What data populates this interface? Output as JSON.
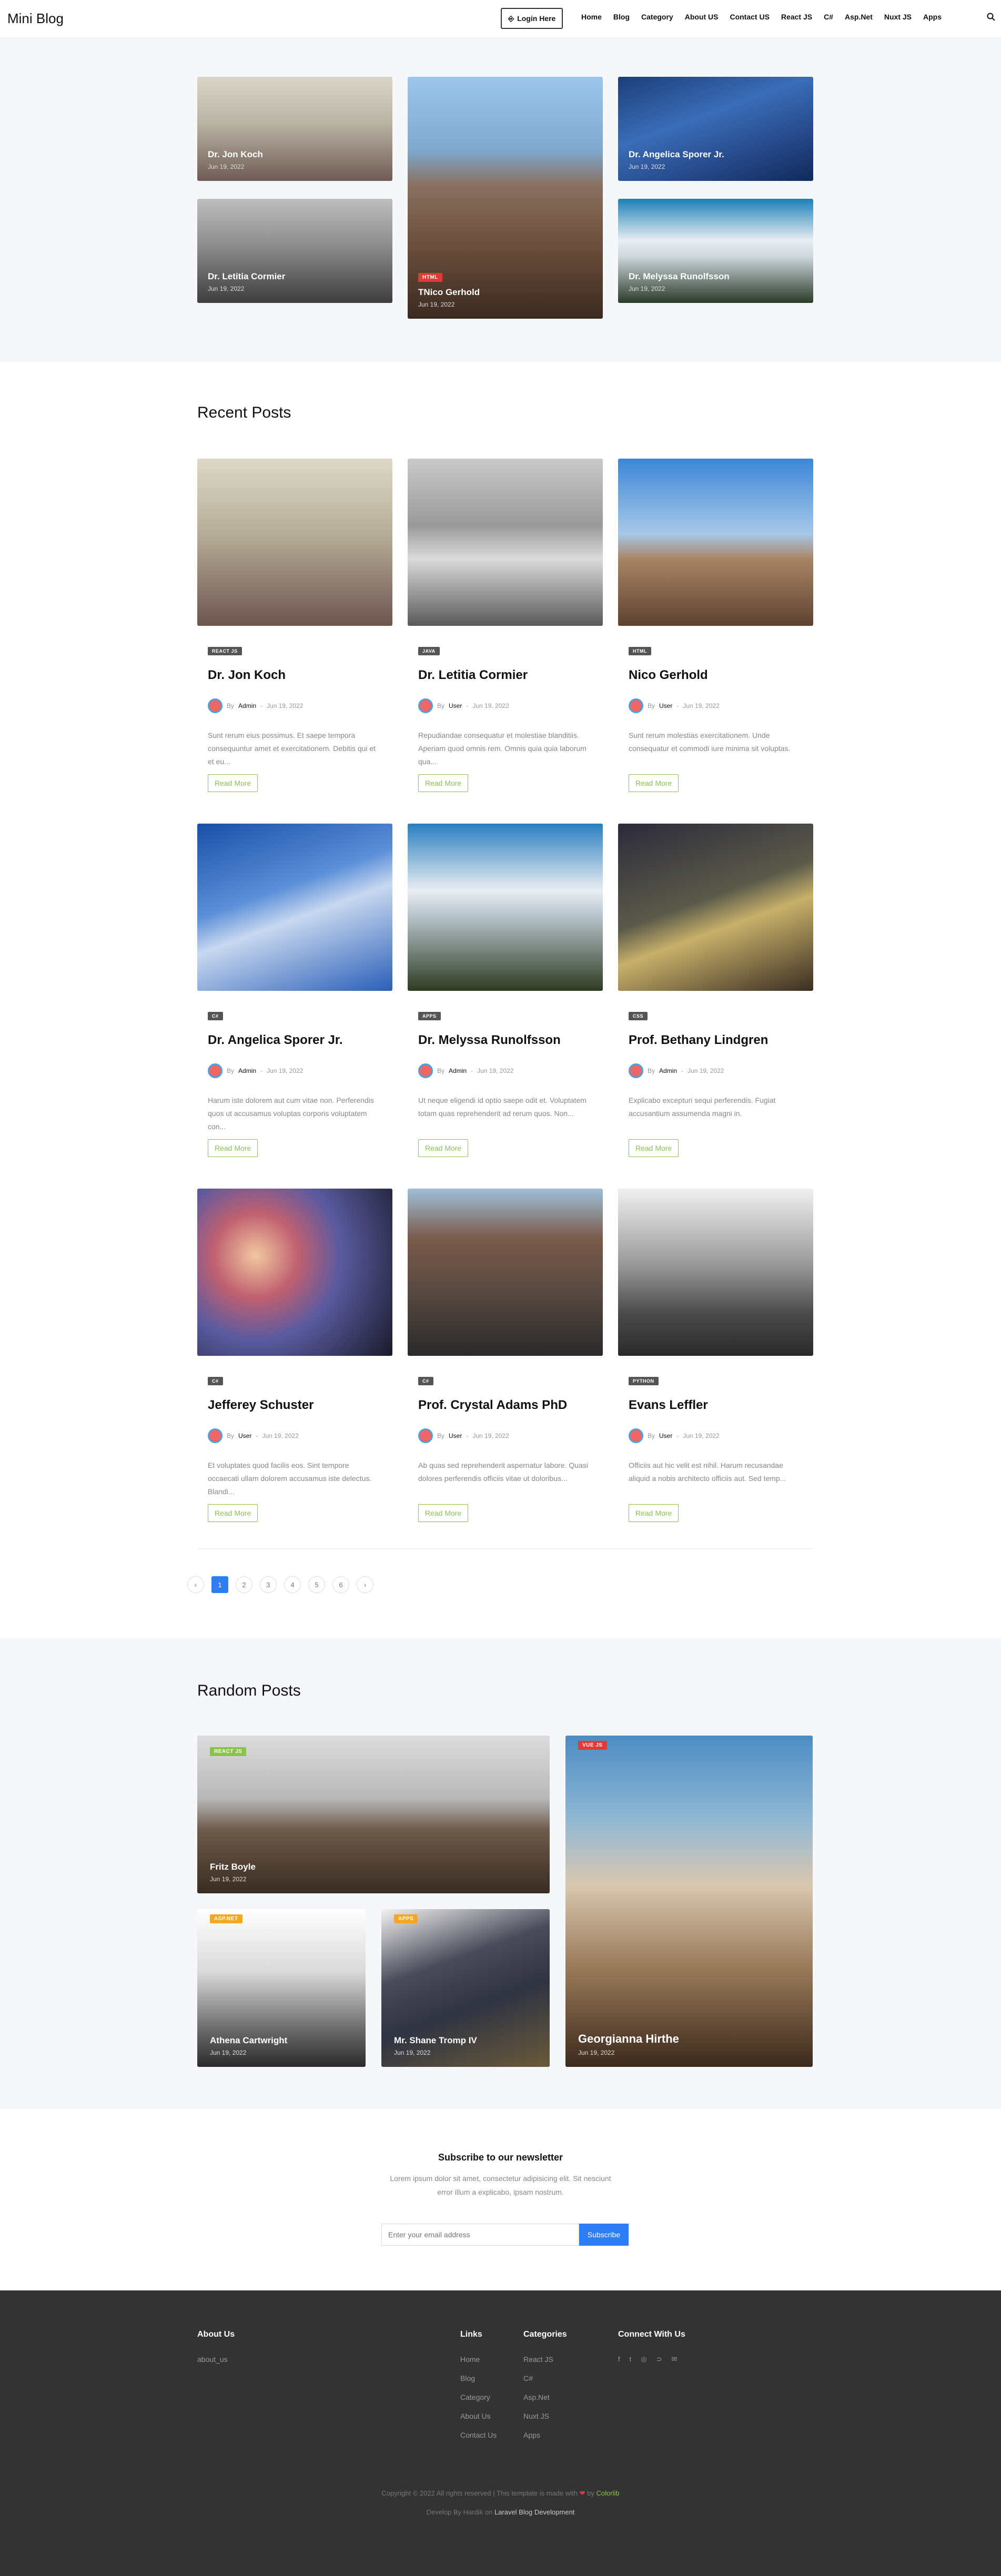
{
  "header": {
    "brand": "Mini Blog",
    "login_label": "Login Here",
    "nav": [
      "Home",
      "Blog",
      "Category",
      "About US",
      "Contact US",
      "React JS",
      "C#",
      "Asp.Net",
      "Nuxt JS",
      "Apps"
    ]
  },
  "hero": [
    {
      "title": "Dr. Jon Koch",
      "date": "Jun 19, 2022"
    },
    {
      "title": "Dr. Letitia Cormier",
      "date": "Jun 19, 2022"
    },
    {
      "badge": "HTML",
      "title": "TNico Gerhold",
      "date": "Jun 19, 2022"
    },
    {
      "title": "Dr. Angelica Sporer Jr.",
      "date": "Jun 19, 2022"
    },
    {
      "title": "Dr. Melyssa Runolfsson",
      "date": "Jun 19, 2022"
    }
  ],
  "recent": {
    "heading": "Recent Posts",
    "by": "By",
    "read_more": "Read More",
    "posts": [
      {
        "tag": "REACT JS",
        "title": "Dr. Jon Koch",
        "author": "Admin",
        "date": "Jun 19, 2022",
        "excerpt": "Sunt rerum eius possimus. Et saepe tempora consequuntur amet et exercitationem. Debitis qui et et eu..."
      },
      {
        "tag": "JAVA",
        "title": "Dr. Letitia Cormier",
        "author": "User",
        "date": "Jun 19, 2022",
        "excerpt": "Repudiandae consequatur et molestiae blanditiis. Aperiam quod omnis rem. Omnis quia quia laborum qua..."
      },
      {
        "tag": "HTML",
        "title": "Nico Gerhold",
        "author": "User",
        "date": "Jun 19, 2022",
        "excerpt": "Sunt rerum molestias exercitationem. Unde consequatur et commodi iure minima sit voluptas."
      },
      {
        "tag": "C#",
        "title": "Dr. Angelica Sporer Jr.",
        "author": "Admin",
        "date": "Jun 19, 2022",
        "excerpt": "Harum iste dolorem aut cum vitae non. Perferendis quos ut accusamus voluptas corporis voluptatem con..."
      },
      {
        "tag": "APPS",
        "title": "Dr. Melyssa Runolfsson",
        "author": "Admin",
        "date": "Jun 19, 2022",
        "excerpt": "Ut neque eligendi id optio saepe odit et. Voluptatem totam quas reprehenderit ad rerum quos. Non..."
      },
      {
        "tag": "CSS",
        "title": "Prof. Bethany Lindgren",
        "author": "Admin",
        "date": "Jun 19, 2022",
        "excerpt": "Explicabo excepturi sequi perferendis. Fugiat accusantium assumenda magni in."
      },
      {
        "tag": "C#",
        "title": "Jefferey Schuster",
        "author": "User",
        "date": "Jun 19, 2022",
        "excerpt": "Et voluptates quod facilis eos. Sint tempore occaecati ullam dolorem accusamus iste delectus. Blandi..."
      },
      {
        "tag": "C#",
        "title": "Prof. Crystal Adams PhD",
        "author": "User",
        "date": "Jun 19, 2022",
        "excerpt": "Ab quas sed reprehenderit aspernatur labore. Quasi dolores perferendis officiis vitae ut doloribus..."
      },
      {
        "tag": "PYTHON",
        "title": "Evans Leffler",
        "author": "User",
        "date": "Jun 19, 2022",
        "excerpt": "Officiis aut hic velit est nihil. Harum recusandae aliquid a nobis architecto officiis aut. Sed temp..."
      }
    ]
  },
  "pagination": {
    "prev": "‹",
    "pages": [
      "1",
      "2",
      "3",
      "4",
      "5",
      "6"
    ],
    "next": "›",
    "current": "1"
  },
  "random": {
    "heading": "Random Posts",
    "posts": [
      {
        "badge": "REACT JS",
        "title": "Fritz Boyle",
        "date": "Jun 19, 2022"
      },
      {
        "badge": "ASP.NET",
        "title": "Athena Cartwright",
        "date": "Jun 19, 2022"
      },
      {
        "badge": "APPS",
        "title": "Mr. Shane Tromp IV",
        "date": "Jun 19, 2022"
      },
      {
        "badge": "VUE JS",
        "title": "Georgianna Hirthe",
        "date": "Jun 19, 2022"
      }
    ]
  },
  "newsletter": {
    "title": "Subscribe to our newsletter",
    "text1": "Lorem ipsum dolor sit amet, consectetur adipisicing elit. Sit nesciunt",
    "text2": "error illum a explicabo, ipsam nostrum.",
    "placeholder": "Enter your email address",
    "button": "Subscribe"
  },
  "footer": {
    "about_title": "About Us",
    "about_text": "about_us",
    "links_title": "Links",
    "links": [
      "Home",
      "Blog",
      "Category",
      "About Us",
      "Contact Us"
    ],
    "cat_title": "Categories",
    "cats": [
      "React JS",
      "C#",
      "Asp.Net",
      "Nuxt JS",
      "Apps"
    ],
    "connect_title": "Connect With Us",
    "copy_a": "Copyright © 2022 All rights reserved | This template is made with",
    "copy_b": "by",
    "copy_c": "Colorlib",
    "dev_a": "Develop By Hardik on",
    "dev_b": "Laravel Blog Development"
  },
  "colors": {
    "accent": "#2e7df6",
    "green": "#8bc34a",
    "red": "#e53935",
    "orange": "#f5a623",
    "footer": "#333333"
  }
}
